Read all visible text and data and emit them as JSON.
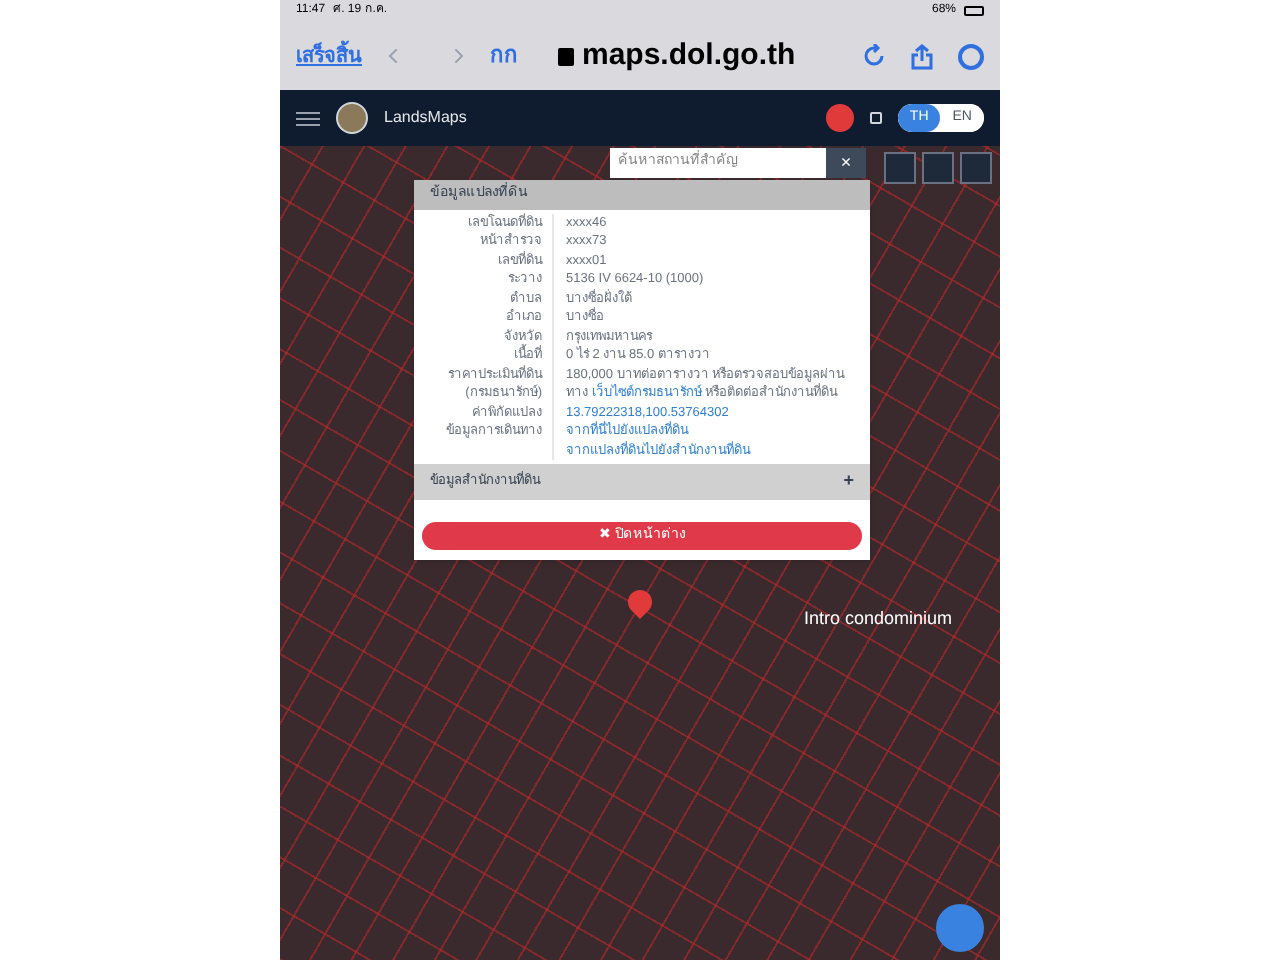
{
  "status_bar": {
    "time": "11:47",
    "date": "ศ. 19 ก.ค.",
    "battery": "68%"
  },
  "browser": {
    "done": "เสร็จสิ้น",
    "text_size": "กก",
    "url": "maps.dol.go.th"
  },
  "app_header": {
    "title": "LandsMaps",
    "languages": [
      {
        "label": "TH",
        "selected": true
      },
      {
        "label": "EN",
        "selected": false
      }
    ]
  },
  "search": {
    "placeholder": "ค้นหาสถานที่สำคัญ",
    "clear": "×"
  },
  "parcel_panel": {
    "title": "ข้อมูลแปลงที่ดิน",
    "rows": [
      {
        "label": "เลขโฉนดที่ดิน",
        "value": "xxxx46",
        "kind": "text"
      },
      {
        "label": "หน้าสำรวจ",
        "value": "xxxx73",
        "kind": "text"
      },
      {
        "label": "เลขที่ดิน",
        "value": "xxxx01",
        "kind": "text"
      },
      {
        "label": "ระวาง",
        "value": "5136 IV 6624-10 (1000)",
        "kind": "text"
      },
      {
        "label": "ตำบล",
        "value": "บางซื่อฝั่งใต้",
        "kind": "text"
      },
      {
        "label": "อำเภอ",
        "value": "บางซื่อ",
        "kind": "text"
      },
      {
        "label": "จังหวัด",
        "value": "กรุงเทพมหานคร",
        "kind": "text"
      },
      {
        "label": "เนื้อที่",
        "value": "0 ไร่ 2 งาน 85.0 ตารางวา",
        "kind": "text"
      },
      {
        "label": "ราคาประเมินที่ดิน",
        "value": "180,000 บาทต่อตารางวา หรือตรวจสอบข้อมูลผ่าน",
        "kind": "text"
      },
      {
        "label": "(กรมธนารักษ์)",
        "value": "ทาง",
        "link": "เว็บไซต์กรมธนารักษ์",
        "after": "หรือติดต่อสำนักงานที่ดิน",
        "kind": "mixed"
      },
      {
        "label": "ค่าพิกัดแปลง",
        "value": "13.79222318,100.53764302",
        "kind": "link"
      },
      {
        "label": "ข้อมูลการเดินทาง",
        "value": "จากที่นี่ไปยังแปลงที่ดิน",
        "kind": "link"
      },
      {
        "label": "",
        "value": "จากแปลงที่ดินไปยังสำนักงานที่ดิน",
        "kind": "link"
      }
    ],
    "office_section": {
      "title": "ข้อมูลสำนักงานที่ดิน",
      "toggle": "+"
    },
    "close_button": "✖ ปิดหน้าต่าง"
  },
  "map_labels": [
    "Intro condominium"
  ]
}
